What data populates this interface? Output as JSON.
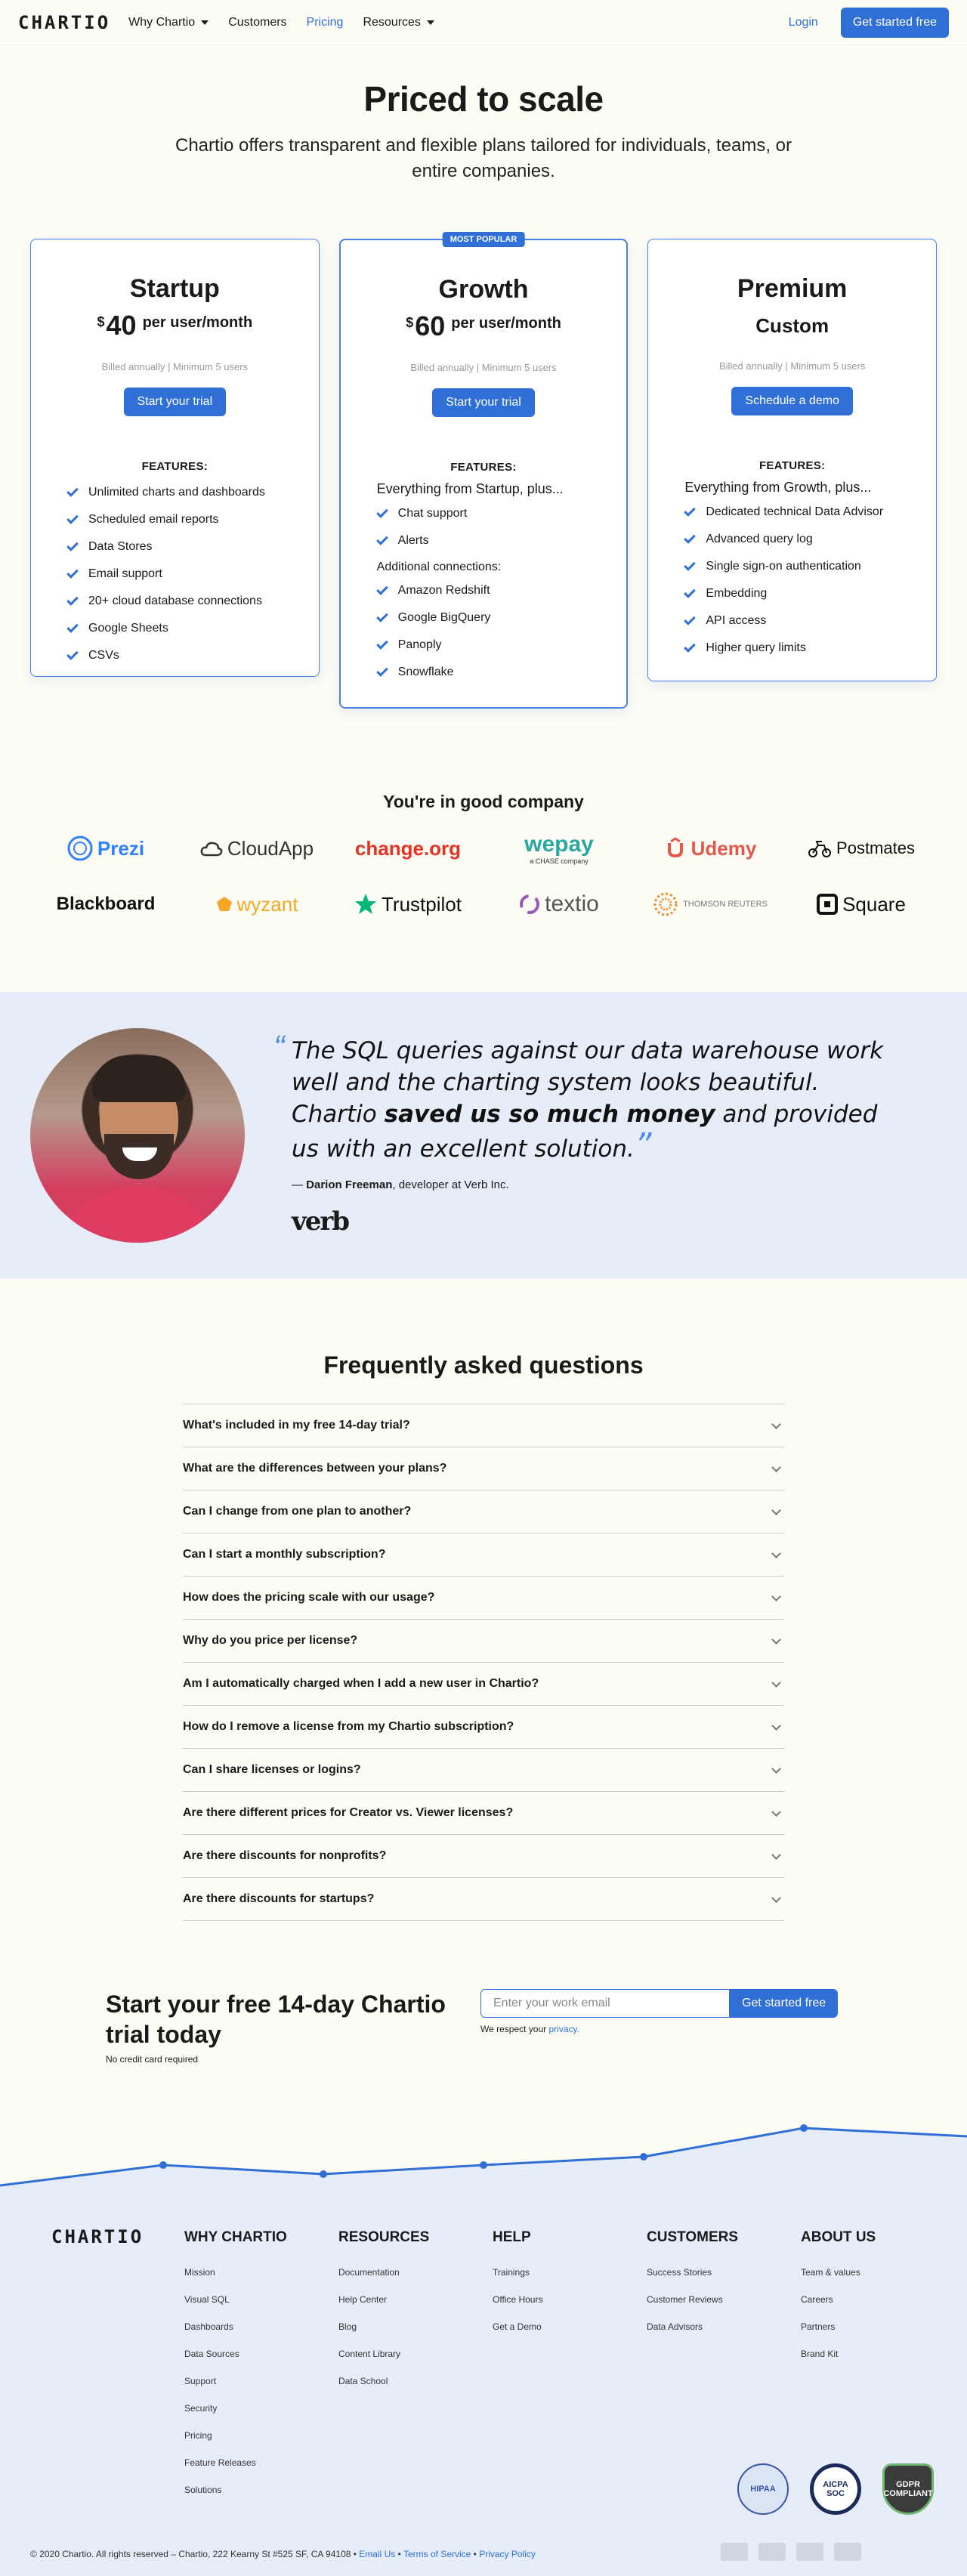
{
  "header": {
    "logo": "CHARTIO",
    "nav": [
      {
        "label": "Why Chartio",
        "dropdown": true
      },
      {
        "label": "Customers",
        "dropdown": false
      },
      {
        "label": "Pricing",
        "dropdown": false,
        "active": true
      },
      {
        "label": "Resources",
        "dropdown": true
      }
    ],
    "login": "Login",
    "cta": "Get started free"
  },
  "hero": {
    "title": "Priced to scale",
    "subtitle": "Chartio offers transparent and flexible plans tailored for individuals, teams, or entire companies."
  },
  "plans": {
    "startup": {
      "name": "Startup",
      "currency": "$",
      "amount": "40",
      "per": "per user/month",
      "billed": "Billed annually | Minimum 5 users",
      "button": "Start your trial",
      "features_label": "FEATURES:",
      "features": [
        "Unlimited charts and dashboards",
        "Scheduled email reports",
        "Data Stores",
        "Email support",
        "20+ cloud database connections",
        "Google Sheets",
        "CSVs"
      ]
    },
    "growth": {
      "badge": "MOST POPULAR",
      "name": "Growth",
      "currency": "$",
      "amount": "60",
      "per": "per user/month",
      "billed": "Billed annually | Minimum 5 users",
      "button": "Start your trial",
      "features_label": "FEATURES:",
      "intro": "Everything from Startup, plus...",
      "features": [
        "Chat support",
        "Alerts"
      ],
      "sub_label": "Additional connections:",
      "connections": [
        "Amazon Redshift",
        "Google BigQuery",
        "Panoply",
        "Snowflake"
      ]
    },
    "premium": {
      "name": "Premium",
      "price": "Custom",
      "billed": "Billed annually | Minimum 5 users",
      "button": "Schedule a demo",
      "features_label": "FEATURES:",
      "intro": "Everything from Growth, plus...",
      "features": [
        "Dedicated technical Data Advisor",
        "Advanced query log",
        "Single sign-on authentication",
        "Embedding",
        "API access",
        "Higher query limits"
      ]
    }
  },
  "company": {
    "title": "You're in good company",
    "logos": {
      "prezi": "Prezi",
      "cloudapp": "CloudApp",
      "changeorg": "change.org",
      "wepay": "wepay",
      "wepay_sub": "a CHASE company",
      "udemy": "Udemy",
      "postmates": "Postmates",
      "blackboard": "Blackboard",
      "wyzant": "wyzant",
      "trustpilot": "Trustpilot",
      "textio": "textio",
      "thomson": "THOMSON REUTERS",
      "square": "Square"
    }
  },
  "testimonial": {
    "quote_start": "The SQL queries against our data warehouse work well and the charting system looks beautiful. Chartio ",
    "quote_bold": "saved us so much money",
    "quote_end": " and provided us with an excellent solution.",
    "dash": "— ",
    "name": "Darion Freeman",
    "role": ", developer at Verb Inc.",
    "company_logo": "verb"
  },
  "faq": {
    "title": "Frequently asked questions",
    "items": [
      "What's included in my free 14-day trial?",
      "What are the differences between your plans?",
      "Can I change from one plan to another?",
      "Can I start a monthly subscription?",
      "How does the pricing scale with our usage?",
      "Why do you price per license?",
      "Am I automatically charged when I add a new user in Chartio?",
      "How do I remove a license from my Chartio subscription?",
      "Can I share licenses or logins?",
      "Are there different prices for Creator vs. Viewer licenses?",
      "Are there discounts for nonprofits?",
      "Are there discounts for startups?"
    ]
  },
  "trial": {
    "title": "Start your free 14-day Chartio trial today",
    "note": "No credit card required",
    "placeholder": "Enter your work email",
    "button": "Get started free",
    "privacy_prefix": "We respect your ",
    "privacy_link": "privacy."
  },
  "footer": {
    "logo": "CHARTIO",
    "columns": [
      {
        "title": "WHY CHARTIO",
        "links": [
          "Mission",
          "Visual SQL",
          "Dashboards",
          "Data Sources",
          "Support",
          "Security",
          "Pricing",
          "Feature Releases",
          "Solutions"
        ]
      },
      {
        "title": "RESOURCES",
        "links": [
          "Documentation",
          "Help Center",
          "Blog",
          "Content Library",
          "Data School"
        ]
      },
      {
        "title": "HELP",
        "links": [
          "Trainings",
          "Office Hours",
          "Get a Demo"
        ]
      },
      {
        "title": "CUSTOMERS",
        "links": [
          "Success Stories",
          "Customer Reviews",
          "Data Advisors"
        ]
      },
      {
        "title": "ABOUT US",
        "links": [
          "Team & values",
          "Careers",
          "Partners",
          "Brand Kit"
        ]
      }
    ],
    "badges": {
      "hipaa": "HIPAA",
      "soc": "AICPA SOC",
      "gdpr": "GDPR COMPLIANT"
    },
    "copyright": "© 2020 Chartio. All rights reserved – Chartio, 222 Kearny St #525 SF, CA 94108 • ",
    "email_link": "Email Us",
    "sep": " • ",
    "terms_link": "Terms of Service",
    "privacy_link": "Privacy Policy"
  },
  "colors": {
    "accent": "#2f6fd6",
    "background": "#fdfcf5",
    "band": "#e6edf8"
  }
}
